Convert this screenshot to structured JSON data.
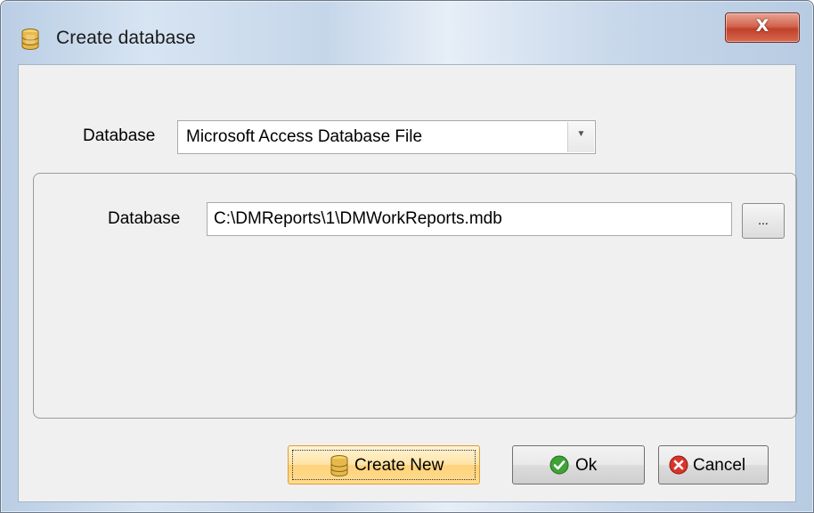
{
  "window": {
    "title": "Create database",
    "close_glyph": "X",
    "icon": "database-icon"
  },
  "form": {
    "database_type_label": "Database",
    "database_type_value": "Microsoft Access Database File",
    "database_path_label": "Database",
    "database_path_value": "C:\\DMReports\\1\\DMWorkReports.mdb",
    "browse_label": "..."
  },
  "buttons": {
    "create_new_label": "Create New",
    "ok_label": "Ok",
    "cancel_label": "Cancel"
  },
  "icons": {
    "create_new": "database-icon",
    "ok": "check-circle-icon",
    "cancel": "cross-circle-icon"
  },
  "colors": {
    "ok_icon": "#3fa338",
    "cancel_icon": "#d9342b",
    "focus_button": "#ffd27a",
    "close_button": "#c1412b"
  }
}
